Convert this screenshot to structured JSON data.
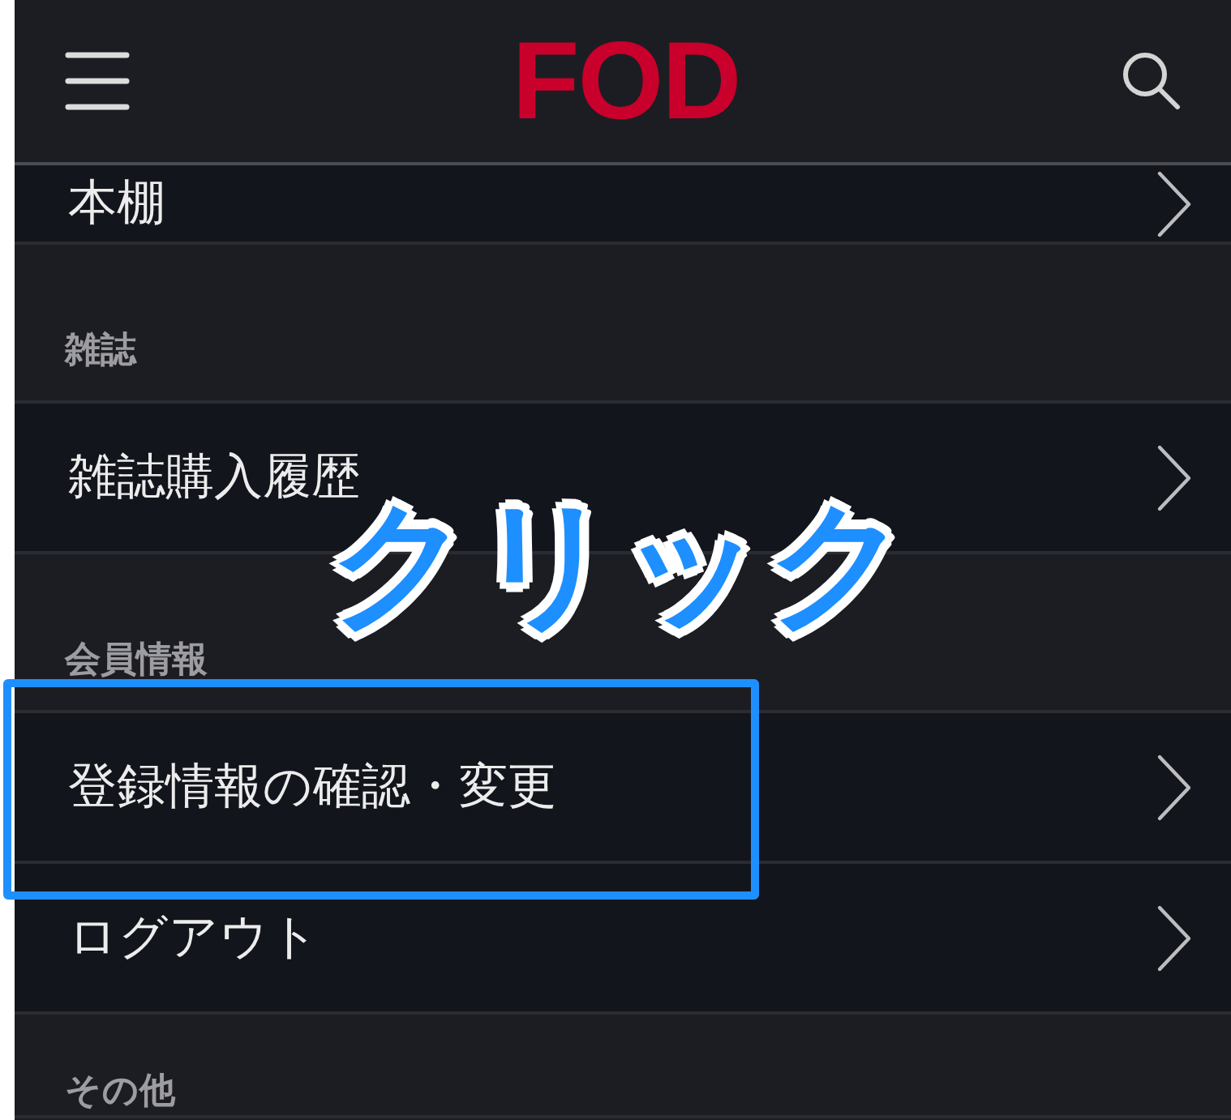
{
  "header": {
    "logo": "FOD"
  },
  "menu": [
    {
      "kind": "link",
      "label": "本棚",
      "highlighted": false
    },
    {
      "kind": "heading",
      "label": "雑誌"
    },
    {
      "kind": "link",
      "label": "雑誌購入履歴",
      "highlighted": false
    },
    {
      "kind": "heading",
      "label": "会員情報"
    },
    {
      "kind": "link",
      "label": "登録情報の確認・変更",
      "highlighted": true
    },
    {
      "kind": "link",
      "label": "ログアウト",
      "highlighted": false
    },
    {
      "kind": "heading",
      "label": "その他"
    }
  ],
  "callout": "クリック"
}
